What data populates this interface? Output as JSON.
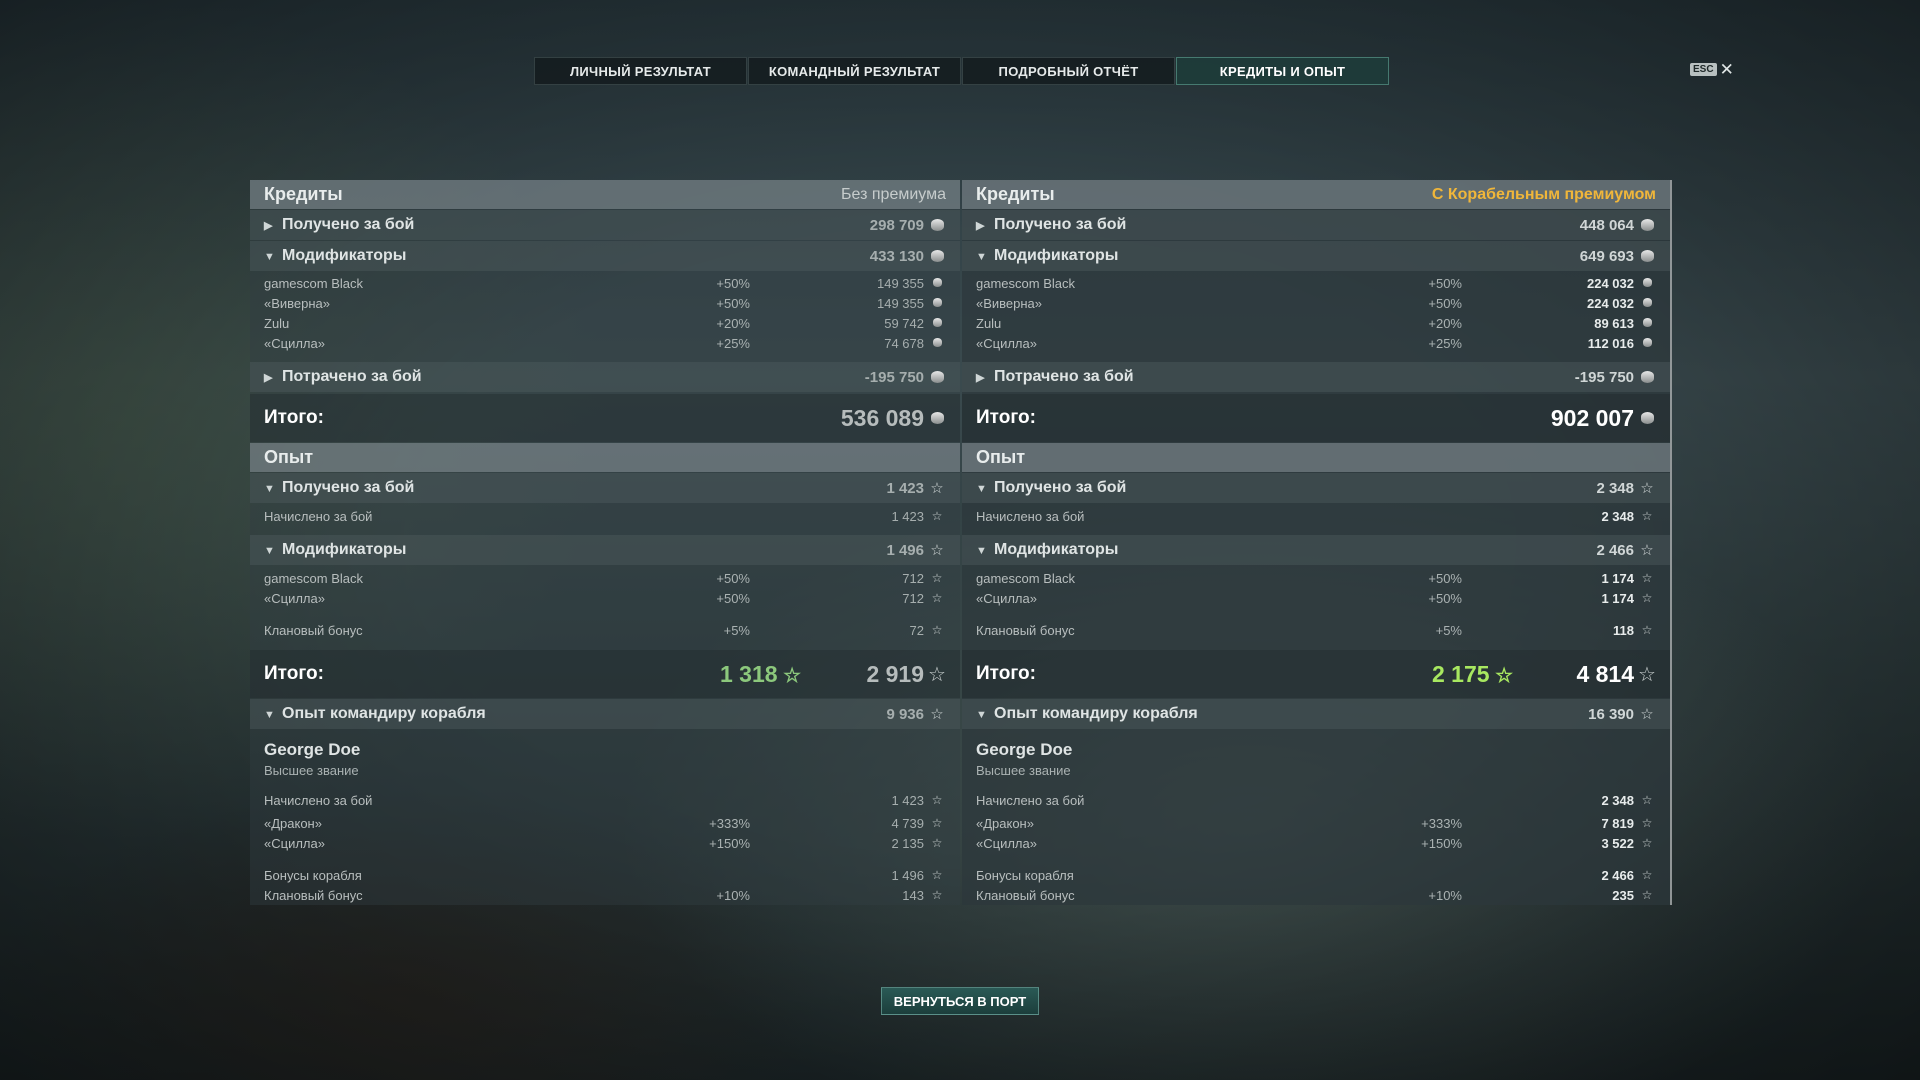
{
  "tabs": [
    "ЛИЧНЫЙ РЕЗУЛЬТАТ",
    "КОМАНДНЫЙ РЕЗУЛЬТАТ",
    "ПОДРОБНЫЙ ОТЧЁТ",
    "КРЕДИТЫ И ОПЫТ"
  ],
  "active_tab": "КРЕДИТЫ И ОПЫТ",
  "esc_label": "ESC",
  "close_glyph": "✕",
  "return_button": "ВЕРНУТЬСЯ В ПОРТ",
  "icons": {
    "credits": "credit-coin-icon",
    "xp": "xp-star-icon"
  },
  "colors": {
    "premium_label": "#f0b63a",
    "free_total_left": "#8cc87c",
    "free_total_right": "#a8e860"
  },
  "left": {
    "credits_title": "Кредиты",
    "credits_sub": "Без премиума",
    "earned_label": "Получено за бой",
    "earned_value": "298 709",
    "mods_label": "Модификаторы",
    "mods_value": "433 130",
    "mods": [
      {
        "name": "gamescom Black",
        "pct": "+50%",
        "value": "149 355"
      },
      {
        "name": "«Виверна»",
        "pct": "+50%",
        "value": "149 355"
      },
      {
        "name": "Zulu",
        "pct": "+20%",
        "value": "59 742"
      },
      {
        "name": "«Сцилла»",
        "pct": "+25%",
        "value": "74 678"
      }
    ],
    "spent_label": "Потрачено за бой",
    "spent_value": "-195 750",
    "total_label": "Итого:",
    "credits_total": "536 089",
    "xp_title": "Опыт",
    "xp_earned_label": "Получено за бой",
    "xp_earned_value": "1 423",
    "xp_accrued_label": "Начислено за бой",
    "xp_accrued_value": "1 423",
    "xp_mods_label": "Модификаторы",
    "xp_mods_value": "1 496",
    "xp_mods": [
      {
        "name": "gamescom Black",
        "pct": "+50%",
        "value": "712"
      },
      {
        "name": "«Сцилла»",
        "pct": "+50%",
        "value": "712"
      }
    ],
    "clan_label": "Клановый бонус",
    "clan_pct": "+5%",
    "clan_value": "72",
    "xp_total_label": "Итого:",
    "xp_free_total": "1 318",
    "xp_total": "2 919",
    "cmd_label": "Опыт командиру корабля",
    "cmd_value": "9 936",
    "cmd_name": "George Doe",
    "cmd_rank": "Высшее звание",
    "cmd_accrued_label": "Начислено за бой",
    "cmd_accrued_value": "1 423",
    "cmd_mods": [
      {
        "name": "«Дракон»",
        "pct": "+333%",
        "value": "4 739"
      },
      {
        "name": "«Сцилла»",
        "pct": "+150%",
        "value": "2 135"
      }
    ],
    "ship_bonus_label": "Бонусы корабля",
    "ship_bonus_value": "1 496",
    "cmd_clan_label": "Клановый бонус",
    "cmd_clan_pct": "+10%",
    "cmd_clan_value": "143"
  },
  "right": {
    "credits_title": "Кредиты",
    "credits_sub": "С Корабельным премиумом",
    "earned_label": "Получено за бой",
    "earned_value": "448 064",
    "mods_label": "Модификаторы",
    "mods_value": "649 693",
    "mods": [
      {
        "name": "gamescom Black",
        "pct": "+50%",
        "value": "224 032"
      },
      {
        "name": "«Виверна»",
        "pct": "+50%",
        "value": "224 032"
      },
      {
        "name": "Zulu",
        "pct": "+20%",
        "value": "89 613"
      },
      {
        "name": "«Сцилла»",
        "pct": "+25%",
        "value": "112 016"
      }
    ],
    "spent_label": "Потрачено за бой",
    "spent_value": "-195 750",
    "total_label": "Итого:",
    "credits_total": "902 007",
    "xp_title": "Опыт",
    "xp_earned_label": "Получено за бой",
    "xp_earned_value": "2 348",
    "xp_accrued_label": "Начислено за бой",
    "xp_accrued_value": "2 348",
    "xp_mods_label": "Модификаторы",
    "xp_mods_value": "2 466",
    "xp_mods": [
      {
        "name": "gamescom Black",
        "pct": "+50%",
        "value": "1 174"
      },
      {
        "name": "«Сцилла»",
        "pct": "+50%",
        "value": "1 174"
      }
    ],
    "clan_label": "Клановый бонус",
    "clan_pct": "+5%",
    "clan_value": "118",
    "xp_total_label": "Итого:",
    "xp_free_total": "2 175",
    "xp_total": "4 814",
    "cmd_label": "Опыт командиру корабля",
    "cmd_value": "16 390",
    "cmd_name": "George Doe",
    "cmd_rank": "Высшее звание",
    "cmd_accrued_label": "Начислено за бой",
    "cmd_accrued_value": "2 348",
    "cmd_mods": [
      {
        "name": "«Дракон»",
        "pct": "+333%",
        "value": "7 819"
      },
      {
        "name": "«Сцилла»",
        "pct": "+150%",
        "value": "3 522"
      }
    ],
    "ship_bonus_label": "Бонусы корабля",
    "ship_bonus_value": "2 466",
    "cmd_clan_label": "Клановый бонус",
    "cmd_clan_pct": "+10%",
    "cmd_clan_value": "235"
  }
}
